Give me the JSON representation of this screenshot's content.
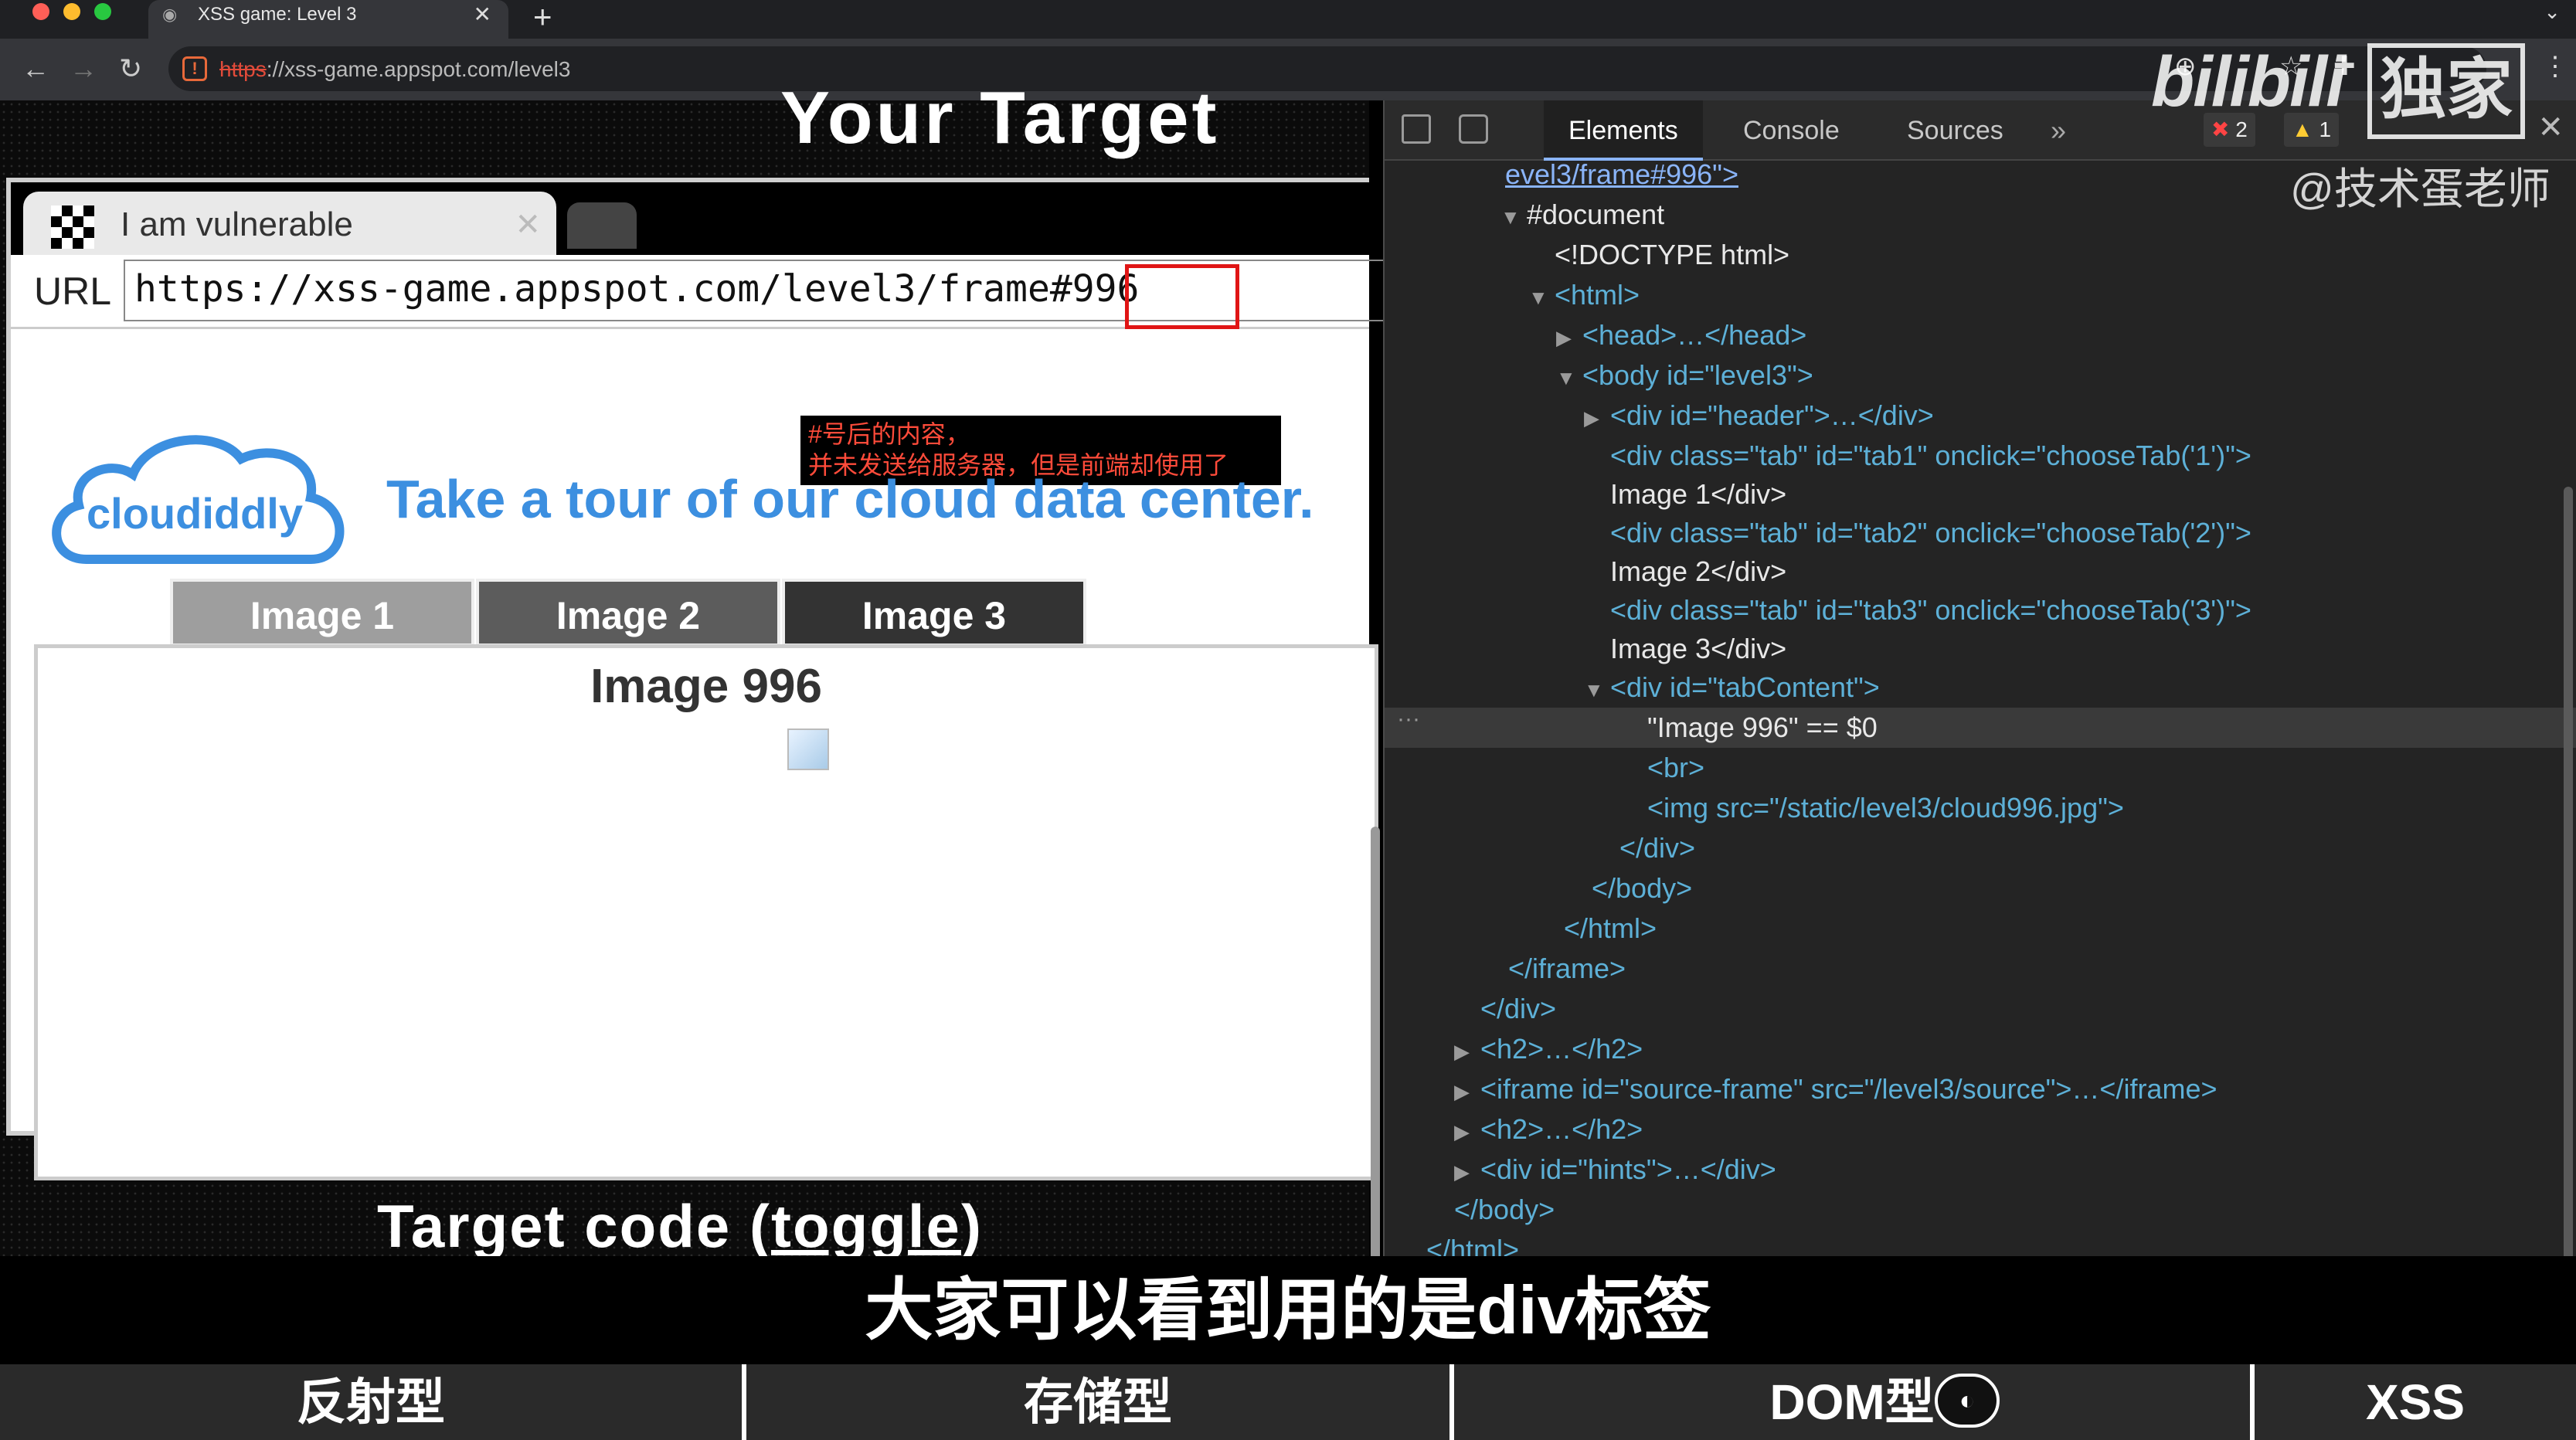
{
  "browser": {
    "tab_title": "XSS game: Level 3",
    "tab_close": "✕",
    "new_tab": "+",
    "menu": "⌄",
    "url_scheme": "https",
    "url_rest": "://xss-game.appspot.com/level3"
  },
  "page": {
    "heading": "Your Target",
    "inner_tab_title": "I am vulnerable",
    "url_label": "URL",
    "url_base": "https://xss-game.appspot.com/level3/frame",
    "url_hash": "#996",
    "annotation_line1": "#号后的内容，",
    "annotation_line2": "并未发送给服务器，但是前端却使用了",
    "logo_text": "cloudiddly",
    "headline": "Take a tour of our cloud data center.",
    "image_tabs": [
      "Image 1",
      "Image 2",
      "Image 3"
    ],
    "content_title": "Image 996",
    "target_code_label": "Target code (",
    "target_code_toggle": "toggle",
    "target_code_end": ")"
  },
  "devtools": {
    "tabs": [
      "Elements",
      "Console",
      "Sources"
    ],
    "more": "»",
    "errors": "2",
    "warnings": "1",
    "close": "✕"
  },
  "dom_lines": [
    {
      "text": "evel3/frame#996\">"
    },
    {
      "text": "#document"
    },
    {
      "text": "<!DOCTYPE html>"
    },
    {
      "text": "<html>"
    },
    {
      "text": "<head>…</head>"
    },
    {
      "text": "<body id=\"level3\">"
    },
    {
      "text": "<div id=\"header\">…</div>"
    },
    {
      "text": "<div class=\"tab\" id=\"tab1\" onclick=\"chooseTab('1')\">"
    },
    {
      "text": "Image 1</div>"
    },
    {
      "text": "<div class=\"tab\" id=\"tab2\" onclick=\"chooseTab('2')\">"
    },
    {
      "text": "Image 2</div>"
    },
    {
      "text": "<div class=\"tab\" id=\"tab3\" onclick=\"chooseTab('3')\">"
    },
    {
      "text": "Image 3</div>"
    },
    {
      "text": "<div id=\"tabContent\">"
    },
    {
      "text": "\"Image 996\" == $0"
    },
    {
      "text": "<br>"
    },
    {
      "text": "<img src=\"/static/level3/cloud996.jpg\">"
    },
    {
      "text": "</div>"
    },
    {
      "text": "</body>"
    },
    {
      "text": "</html>"
    },
    {
      "text": "</iframe>"
    },
    {
      "text": "</div>"
    },
    {
      "text": "<h2>…</h2>"
    },
    {
      "text": "<iframe id=\"source-frame\" src=\"/level3/source\">…</iframe>"
    },
    {
      "text": "<h2>…</h2>"
    },
    {
      "text": "<div id=\"hints\">…</div>"
    },
    {
      "text": "</body>"
    },
    {
      "text": "</html>"
    }
  ],
  "overlay": {
    "watermark": "@技术蛋老师",
    "bili_logo": "bilibili",
    "bili_box": "独家",
    "subtitle": "大家可以看到用的是div标签",
    "chapters": [
      "反射型",
      "存储型",
      "DOM型",
      "XSS"
    ]
  },
  "colors": {
    "accent_blue": "#3c8fe0",
    "annotation_red": "#e01515",
    "tab1_bg": "#9e9e9e",
    "tab2_bg": "#5c5c5c",
    "tab3_bg": "#333333"
  }
}
